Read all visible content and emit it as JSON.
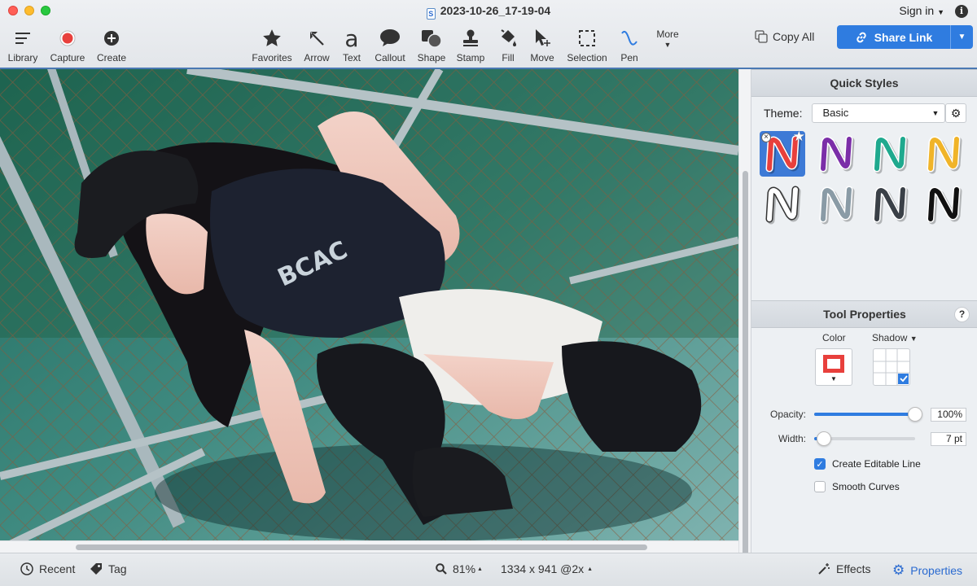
{
  "window": {
    "title": "2023-10-26_17-19-04",
    "signin_label": "Sign in",
    "info_label": "i"
  },
  "toolbar": {
    "left": [
      {
        "label": "Library",
        "icon": "list-icon"
      },
      {
        "label": "Capture",
        "icon": "record-icon"
      },
      {
        "label": "Create",
        "icon": "plus-circle-icon"
      }
    ],
    "tools": [
      {
        "label": "Favorites",
        "icon": "star-icon"
      },
      {
        "label": "Arrow",
        "icon": "arrow-icon"
      },
      {
        "label": "Text",
        "icon": "text-a-icon"
      },
      {
        "label": "Callout",
        "icon": "speech-bubble-icon"
      },
      {
        "label": "Shape",
        "icon": "shape-icon"
      },
      {
        "label": "Stamp",
        "icon": "stamp-icon"
      },
      {
        "label": "Fill",
        "icon": "paint-bucket-icon"
      },
      {
        "label": "Move",
        "icon": "cursor-move-icon"
      },
      {
        "label": "Selection",
        "icon": "dashed-rect-icon"
      },
      {
        "label": "Pen",
        "icon": "pen-curve-icon"
      }
    ],
    "more_label": "More",
    "copy_all_label": "Copy All",
    "share_link_label": "Share Link"
  },
  "canvas": {
    "image_text": "BCAC"
  },
  "quick_styles": {
    "title": "Quick Styles",
    "theme_label": "Theme:",
    "theme_value": "Basic",
    "styles": [
      {
        "color": "#e8403c",
        "outline": "#ffffff"
      },
      {
        "color": "#7b2ea8",
        "outline": "#ffffff"
      },
      {
        "color": "#1fa98e",
        "outline": "#ffffff"
      },
      {
        "color": "#f0b429",
        "outline": "#ffffff"
      },
      {
        "color": "#ffffff",
        "outline": "#333333"
      },
      {
        "color": "#8a9ba6",
        "outline": "#ffffff"
      },
      {
        "color": "#3a4047",
        "outline": "#ffffff"
      },
      {
        "color": "#111111",
        "outline": "#ffffff"
      }
    ]
  },
  "tool_properties": {
    "title": "Tool Properties",
    "help_label": "?",
    "color_label": "Color",
    "shadow_label": "Shadow",
    "color_value": "#e8403c",
    "opacity_label": "Opacity:",
    "opacity_value": "100%",
    "opacity_fraction": 1.0,
    "width_label": "Width:",
    "width_value": "7 pt",
    "width_fraction": 0.1,
    "create_editable_line_label": "Create Editable Line",
    "create_editable_line_checked": true,
    "smooth_curves_label": "Smooth Curves",
    "smooth_curves_checked": false
  },
  "bottombar": {
    "recent_label": "Recent",
    "tag_label": "Tag",
    "zoom_value": "81%",
    "dimensions": "1334 x 941 @2x",
    "effects_label": "Effects",
    "properties_label": "Properties"
  },
  "colors": {
    "accent": "#2f7ce0",
    "capture_red": "#e8403c"
  }
}
